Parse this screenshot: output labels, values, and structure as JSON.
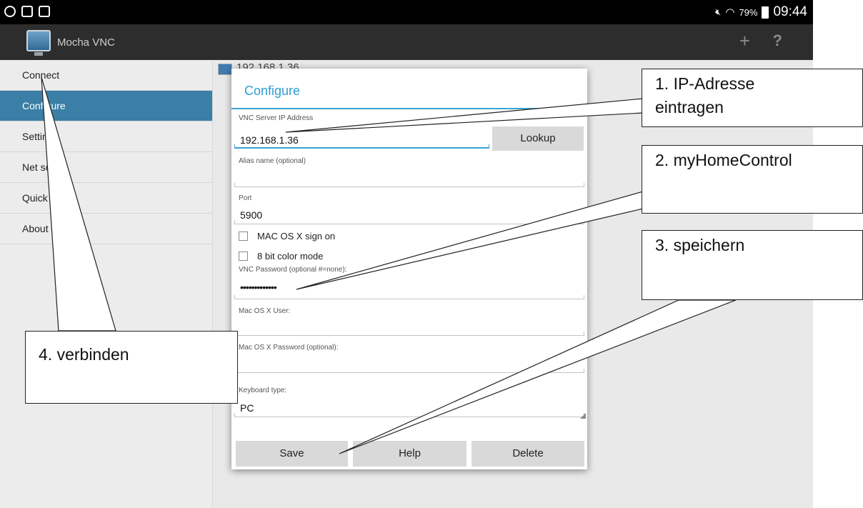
{
  "status_bar": {
    "battery": "79%",
    "time": "09:44",
    "icons": [
      "whatsapp-icon",
      "image-icon",
      "bag-icon",
      "mute-icon",
      "wifi-icon",
      "battery-icon"
    ]
  },
  "action_bar": {
    "title": "Mocha VNC",
    "add_label": "+",
    "help_label": "?"
  },
  "sidebar": {
    "items": [
      {
        "label": "Connect"
      },
      {
        "label": "Configure"
      },
      {
        "label": "Settings"
      },
      {
        "label": "Net scans"
      },
      {
        "label": "Quick scroll"
      },
      {
        "label": "About"
      }
    ],
    "active": "Configure"
  },
  "content": {
    "host": "192.168.1.36"
  },
  "dialog": {
    "title": "Configure",
    "ip_label": "VNC Server IP Address",
    "ip_value": "192.168.1.36",
    "lookup_label": "Lookup",
    "alias_label": "Alias name (optional)",
    "alias_value": "",
    "port_label": "Port",
    "port_value": "5900",
    "mac_sign_on_label": "MAC OS X sign on",
    "mac_sign_on_checked": false,
    "bit8_label": "8 bit color mode",
    "bit8_checked": false,
    "vnc_password_label": "VNC Password (optional #=none):",
    "vnc_password_value": "•••••••••••••",
    "mac_user_label": "Mac OS X User:",
    "mac_user_value": "",
    "mac_password_label": "Mac OS X Password (optional):",
    "mac_password_value": "",
    "keyboard_label": "Keyboard type:",
    "keyboard_value": "PC",
    "buttons": {
      "save": "Save",
      "help": "Help",
      "delete": "Delete"
    }
  },
  "callouts": {
    "step1_line1": "1. IP-Adresse",
    "step1_line2": "eintragen",
    "step2": "2. myHomeControl",
    "step3": "3. speichern",
    "step4": "4. verbinden"
  },
  "colors": {
    "accent": "#3ba3d6",
    "sidebar_active": "#3a7fa6",
    "action_bar": "#2d2d2d",
    "button": "#d9d9d9"
  }
}
